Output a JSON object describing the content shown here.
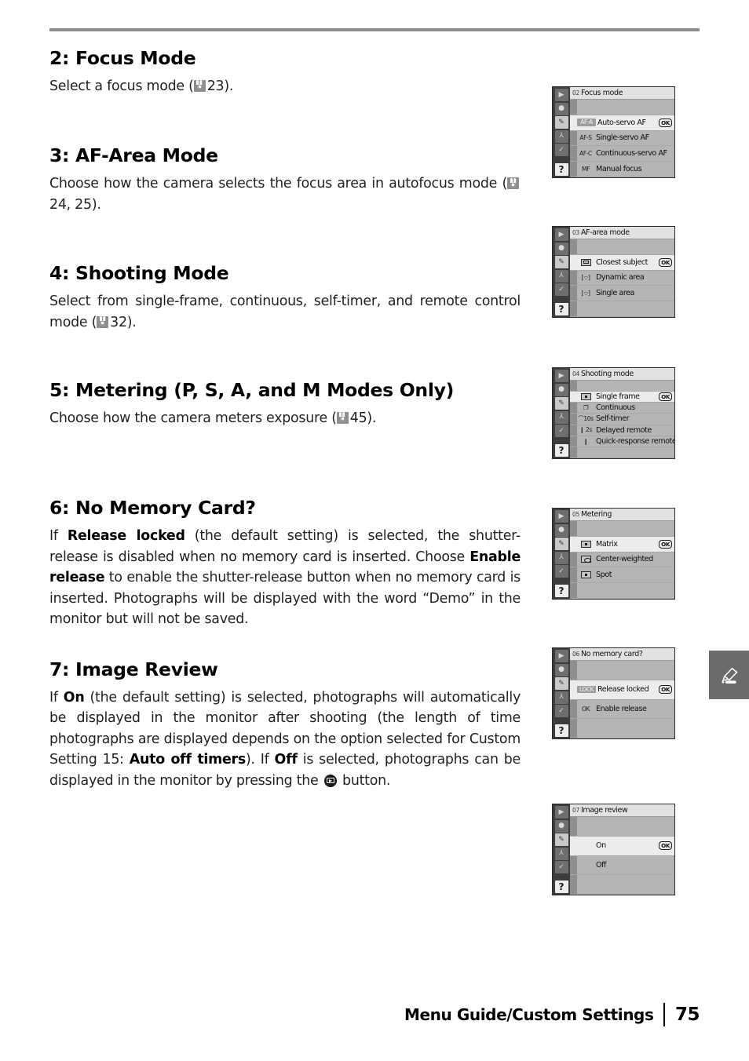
{
  "page": {
    "number": "75",
    "chapter": "Menu Guide/Custom Settings"
  },
  "sections": [
    {
      "title": "2: Focus Mode",
      "body_prefix": "Select a focus mode (",
      "ref": "23).",
      "body_plain": "Select a focus mode (✰ 23)."
    },
    {
      "title": "3: AF-Area Mode",
      "body_prefix": "Choose how the camera selects the focus area in autofocus mode (",
      "ref": "24, 25).",
      "body_plain": "Choose how the camera selects the focus area in autofocus mode (✰ 24, 25)."
    },
    {
      "title": "4: Shooting Mode",
      "body_prefix": "Select from single-frame, continuous, self-timer, and remote control mode (",
      "ref": "32).",
      "body_plain": "Select from single-frame, continuous, self-timer, and remote control mode (✰ 32)."
    },
    {
      "title": "5: Metering (P, S, A, and M Modes Only)",
      "body_prefix": "Choose how the camera meters exposure (",
      "ref": "45).",
      "body_plain": "Choose how the camera meters exposure (✰ 45)."
    },
    {
      "title": "6: No Memory Card?",
      "parts": [
        {
          "type": "text",
          "value": "If "
        },
        {
          "type": "bold",
          "value": "Release locked"
        },
        {
          "type": "text",
          "value": " (the default setting) is selected, the shutter-release is disabled when no memory card is inserted.  Choose "
        },
        {
          "type": "bold",
          "value": "Enable release"
        },
        {
          "type": "text",
          "value": " to enable the shutter-release button when no memory card is inserted.  Photographs will be displayed with the word “Demo” in the monitor but will not be saved."
        }
      ]
    },
    {
      "title": "7: Image Review",
      "parts": [
        {
          "type": "text",
          "value": "If "
        },
        {
          "type": "bold",
          "value": "On"
        },
        {
          "type": "text",
          "value": " (the default setting) is selected, photographs will automatically be displayed in the monitor after shooting (the length of time photographs are displayed depends on the option selected for Custom Setting 15: "
        },
        {
          "type": "bold",
          "value": "Auto off timers"
        },
        {
          "type": "text",
          "value": ").  If "
        },
        {
          "type": "bold",
          "value": "Off"
        },
        {
          "type": "text",
          "value": " is selected, photographs can be displayed in the monitor by pressing the "
        },
        {
          "type": "icon",
          "value": "playback-button-icon"
        },
        {
          "type": "text",
          "value": " button."
        }
      ]
    }
  ],
  "sidebar_icons": [
    {
      "name": "playback-icon",
      "glyph": "▶",
      "active": false
    },
    {
      "name": "shooting-menu-icon",
      "glyph": "●",
      "active": false
    },
    {
      "name": "custom-settings-pencil-icon",
      "glyph": "✎",
      "active": true
    },
    {
      "name": "setup-wrench-icon",
      "glyph": "⅄",
      "active": false
    },
    {
      "name": "retouch-icon",
      "glyph": "✓",
      "active": false
    },
    {
      "name": "help-icon",
      "glyph": "?",
      "active": false
    }
  ],
  "menus": [
    {
      "id": "focus-mode",
      "number": "02",
      "title": "Focus mode",
      "lead_blank": true,
      "trail_blank": false,
      "rows": [
        {
          "badge": "AF-A",
          "badge_style": "boxed",
          "label": "Auto-servo AF",
          "selected": true,
          "ok": "OK"
        },
        {
          "badge": "AF-S",
          "badge_style": "plain",
          "label": "Single-servo AF",
          "selected": false,
          "ok": ""
        },
        {
          "badge": "AF-C",
          "badge_style": "plain",
          "label": "Continuous-servo AF",
          "selected": false,
          "ok": ""
        },
        {
          "badge": "MF",
          "badge_style": "plain",
          "label": "Manual focus",
          "selected": false,
          "ok": ""
        }
      ]
    },
    {
      "id": "af-area-mode",
      "number": "03",
      "title": "AF-area mode",
      "lead_blank": true,
      "trail_blank": true,
      "rows": [
        {
          "badge": "glyph-frame",
          "badge_style": "glyph",
          "label": "Closest subject",
          "selected": true,
          "ok": "OK"
        },
        {
          "badge": "[·:·]",
          "badge_style": "bracket",
          "label": "Dynamic area",
          "selected": false,
          "ok": ""
        },
        {
          "badge": "[·:·]",
          "badge_style": "bracket",
          "label": "Single area",
          "selected": false,
          "ok": ""
        }
      ]
    },
    {
      "id": "shooting-mode",
      "number": "04",
      "title": "Shooting mode",
      "lead_blank": true,
      "trail_blank": true,
      "rows": [
        {
          "badge": "glyph-dot",
          "badge_style": "glyph",
          "label": "Single frame",
          "selected": true,
          "ok": "OK"
        },
        {
          "badge": "❐",
          "badge_style": "plain",
          "label": "Continuous",
          "selected": false,
          "ok": ""
        },
        {
          "badge": "⌒10s",
          "badge_style": "plain",
          "label": "Self-timer",
          "selected": false,
          "ok": ""
        },
        {
          "badge": "❙ 2s",
          "badge_style": "plain",
          "label": "Delayed remote",
          "selected": false,
          "ok": ""
        },
        {
          "badge": "❙",
          "badge_style": "plain",
          "label": "Quick-response remote",
          "selected": false,
          "ok": ""
        }
      ]
    },
    {
      "id": "metering",
      "number": "05",
      "title": "Metering",
      "lead_blank": true,
      "trail_blank": true,
      "rows": [
        {
          "badge": "glyph-matrix",
          "badge_style": "glyph",
          "label": "Matrix",
          "selected": true,
          "ok": "OK"
        },
        {
          "badge": "glyph-cw",
          "badge_style": "glyph",
          "label": "Center-weighted",
          "selected": false,
          "ok": ""
        },
        {
          "badge": "glyph-dot",
          "badge_style": "glyph",
          "label": "Spot",
          "selected": false,
          "ok": ""
        }
      ]
    },
    {
      "id": "no-memory-card",
      "number": "06",
      "title": "No memory card?",
      "lead_blank": true,
      "trail_blank": true,
      "rows": [
        {
          "badge": "LOCK",
          "badge_style": "boxed",
          "label": "Release locked",
          "selected": true,
          "ok": "OK"
        },
        {
          "badge": "OK",
          "badge_style": "plain",
          "label": "Enable release",
          "selected": false,
          "ok": ""
        }
      ]
    },
    {
      "id": "image-review",
      "number": "07",
      "title": "Image review",
      "lead_blank": true,
      "trail_blank": true,
      "rows": [
        {
          "badge": "",
          "badge_style": "plain",
          "label": "On",
          "selected": true,
          "ok": "OK"
        },
        {
          "badge": "",
          "badge_style": "plain",
          "label": "Off",
          "selected": false,
          "ok": ""
        }
      ]
    }
  ],
  "chapter_tab": {
    "icon": "pencil-icon"
  },
  "colors": {
    "rule": "#8c8c8c",
    "tab_bg": "#6b6b6b",
    "lcd_bg": "#bdbdbd",
    "lcd_title_bg": "#e2e2e2",
    "lcd_sidebar": "#3c3c3c",
    "selected_row": "#ececec"
  }
}
